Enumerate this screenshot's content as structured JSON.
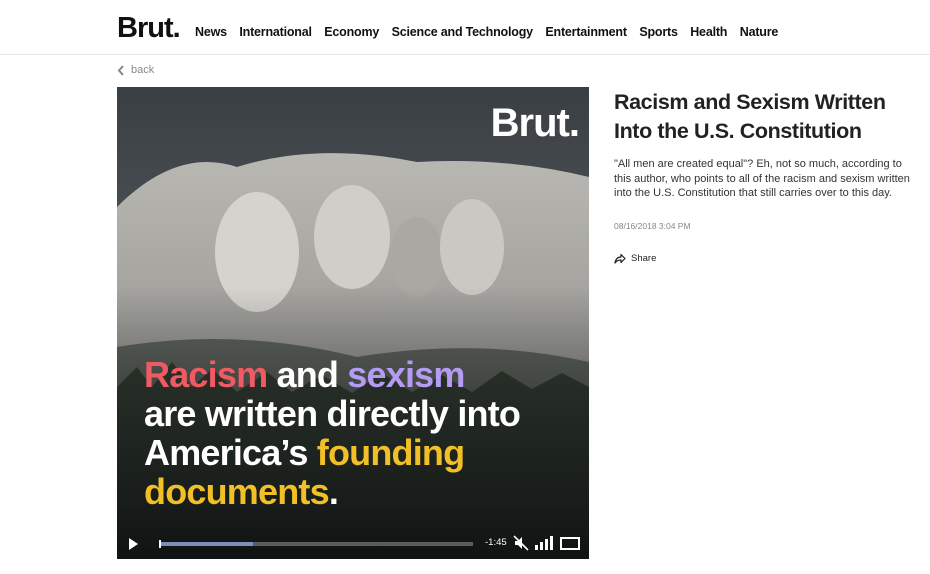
{
  "brand": {
    "logo": "Brut."
  },
  "nav": {
    "items": [
      "News",
      "International",
      "Economy",
      "Science and Technology",
      "Entertainment",
      "Sports",
      "Health",
      "Nature"
    ]
  },
  "back": {
    "label": "back"
  },
  "video": {
    "watermark": "Brut.",
    "caption": {
      "w1": "Racism",
      "w2": " and ",
      "w3": "sexism",
      "line2": "are written directly into",
      "line3a": "America’s ",
      "line3b": "founding",
      "line4a": "documents",
      "line4b": "."
    },
    "time": "-1:45",
    "progress_fraction": 0.3,
    "icons": {
      "play": "play-icon",
      "mute": "muted-speaker-icon",
      "quality": "signal-bars-icon",
      "fullscreen": "fullscreen-icon"
    }
  },
  "article": {
    "title": "Racism and Sexism Written Into the U.S. Constitution",
    "description": "\"All men are created equal\"? Eh, not so much, according to this author, who points to all of the racism and sexism written into the U.S. Constitution that still carries over to this day.",
    "date": "08/16/2018 3:04 PM",
    "share_label": "Share"
  },
  "colors": {
    "red_word": "#f05a63",
    "purple_word": "#b39cf2",
    "yellow_word": "#f0c026",
    "progress": "#7b8fb8"
  }
}
